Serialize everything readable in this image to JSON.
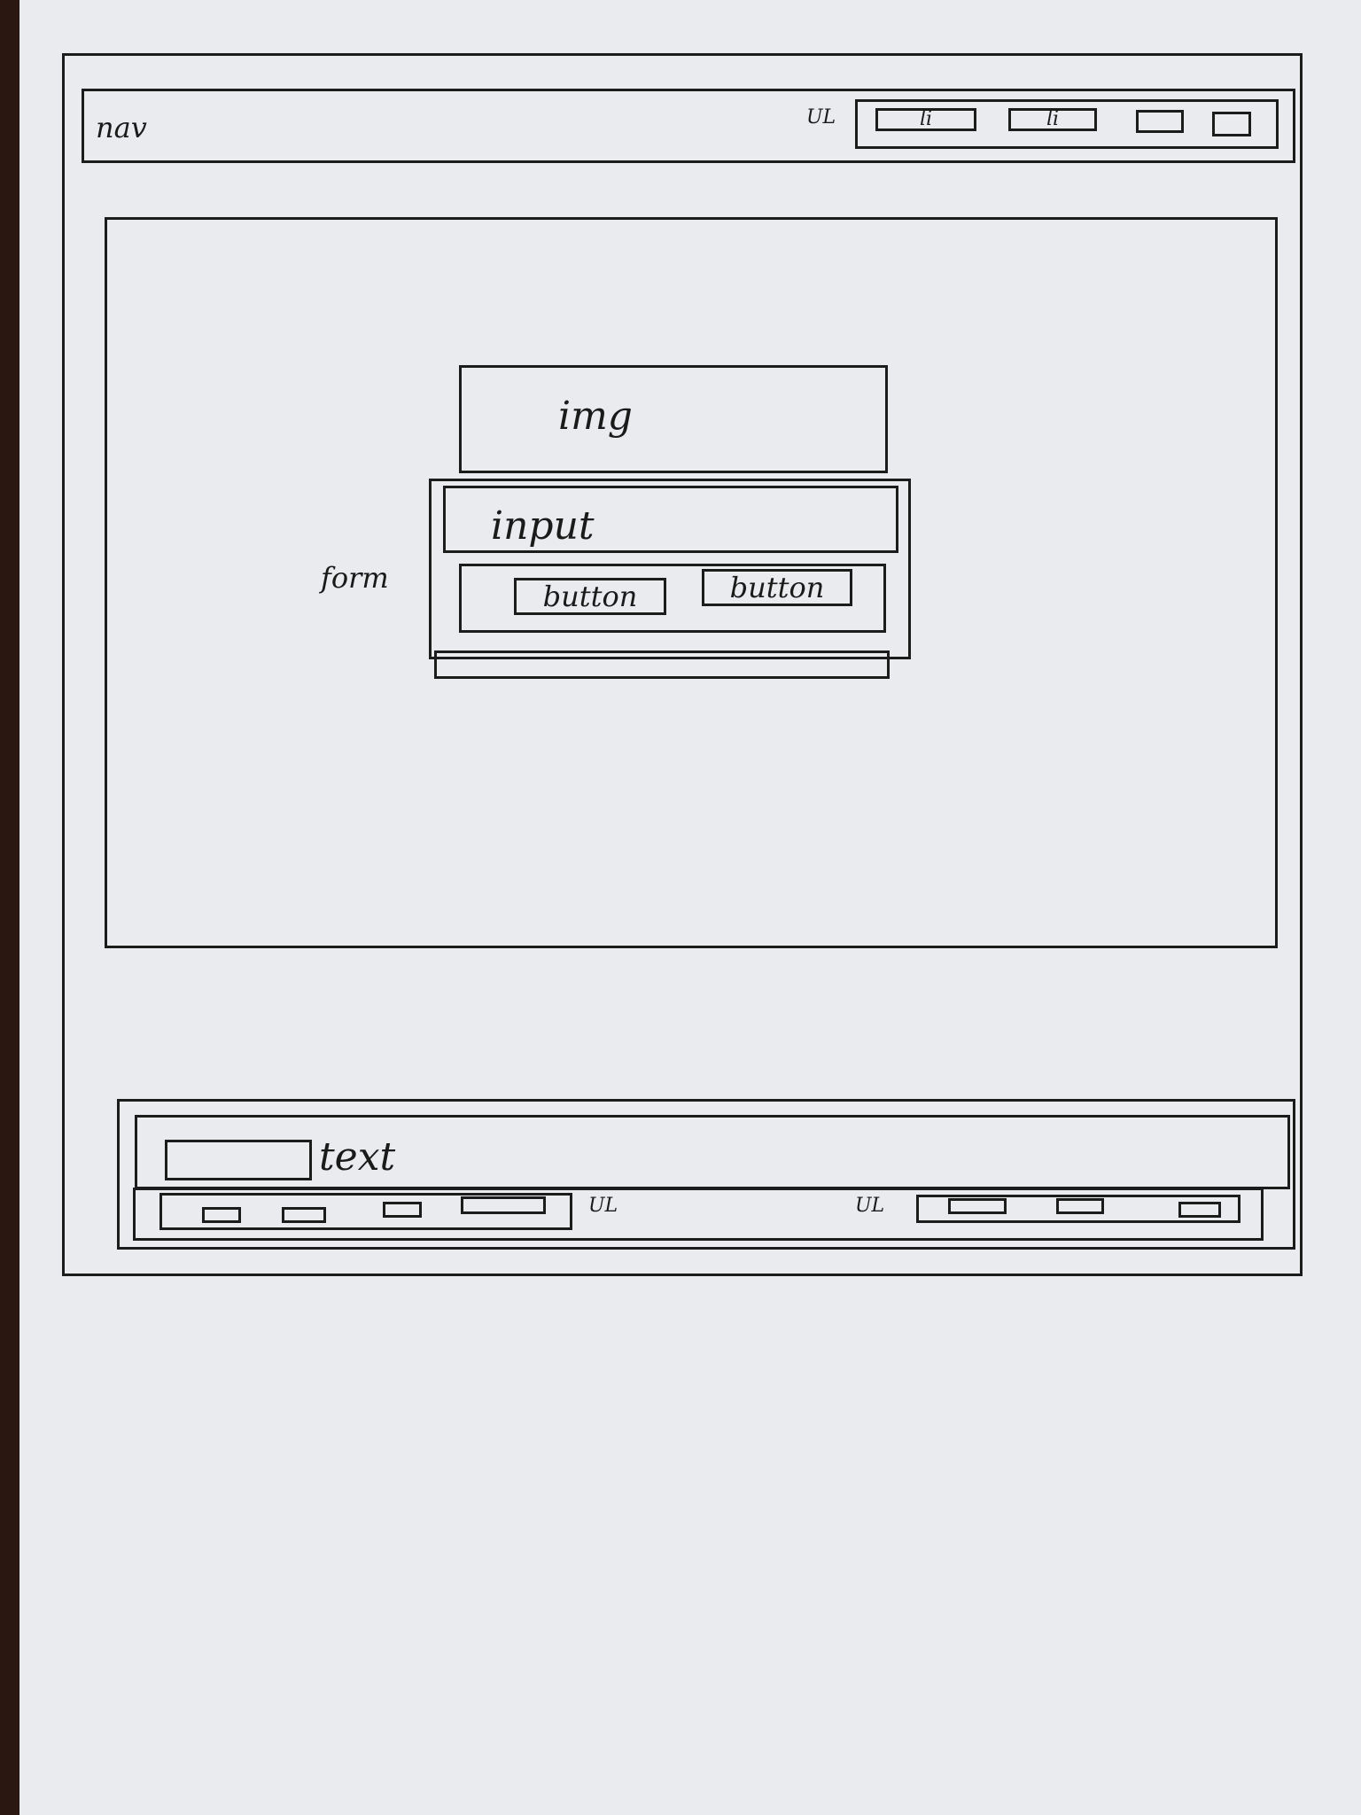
{
  "nav": {
    "label": "nav",
    "ul_label": "UL",
    "items": [
      "li",
      "li"
    ]
  },
  "main": {
    "img_label": "img",
    "form_label": "form",
    "input_label": "input",
    "buttons": [
      "button",
      "button"
    ]
  },
  "footer": {
    "text_label": "text",
    "ul_left_label": "UL",
    "ul_right_label": "UL"
  }
}
